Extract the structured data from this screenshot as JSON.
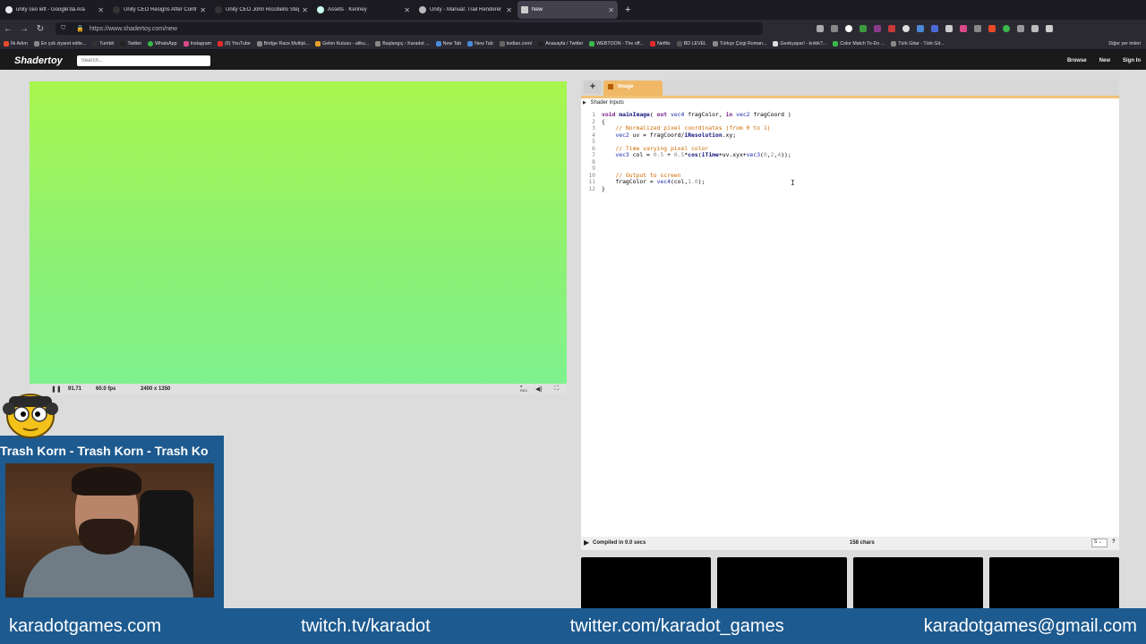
{
  "browser": {
    "tabs": [
      {
        "title": "unity ceo left - Google'da Ara",
        "fav": "#e7eaf0"
      },
      {
        "title": "Unity CEO Resigns After Contro",
        "fav": "#333"
      },
      {
        "title": "Unity CEO John Riccitiello Steps",
        "fav": "#333"
      },
      {
        "title": "Assets · Kenney",
        "fav": "#cfe"
      },
      {
        "title": "Unity - Manual: Trail Renderer c",
        "fav": "#bbb"
      },
      {
        "title": "New",
        "fav": "#ccc"
      }
    ],
    "url": "https://www.shadertoy.com/new",
    "bookmarks": [
      "İlk Adım",
      "En çok ziyaret edile...",
      "Tumblr",
      "Twitter",
      "WhatsApp",
      "Instagram",
      "(6) YouTube",
      "Bridge Race Multipl...",
      "Gelen Kutusu - aliku...",
      "Başlangıç ‹ Karadot ...",
      "New Tab",
      "New Tab",
      "kodlan.com/",
      "Anasayfa / Twitter",
      "WEBTOON - The off...",
      "Netflix",
      "BD LEVEL",
      "Türkçe Çizgi Roman...",
      "Geekyapar! - kırkik?...",
      "Color Match To-Do ...",
      "Türk Gitar - Türk Git..."
    ],
    "other_bookmarks": "Diğer yer imleri"
  },
  "shadertoy": {
    "logo": "Shadertoy",
    "search_placeholder": "Search...",
    "nav": [
      "Browse",
      "New",
      "Sign In"
    ]
  },
  "player": {
    "time": "91.71",
    "fps": "60.0 fps",
    "resolution": "2400 x 1350",
    "rec_label": "REC"
  },
  "editor": {
    "tab_add": "+",
    "tab_label": "Image",
    "shader_inputs": "Shader Inputs",
    "line_numbers": [
      "1",
      "2",
      "3",
      "4",
      "5",
      "6",
      "7",
      "8",
      "9",
      "10",
      "11",
      "12"
    ],
    "compiled": "Compiled in 0.0 secs",
    "chars": "158 chars",
    "font_size_value": "S",
    "help": "?"
  },
  "overlay": {
    "marquee": "Trash Korn - Trash Korn - Trash Ko",
    "footer": [
      "karadotgames.com",
      "twitch.tv/karadot",
      "twitter.com/karadot_games",
      "karadotgames@gmail.com"
    ]
  }
}
